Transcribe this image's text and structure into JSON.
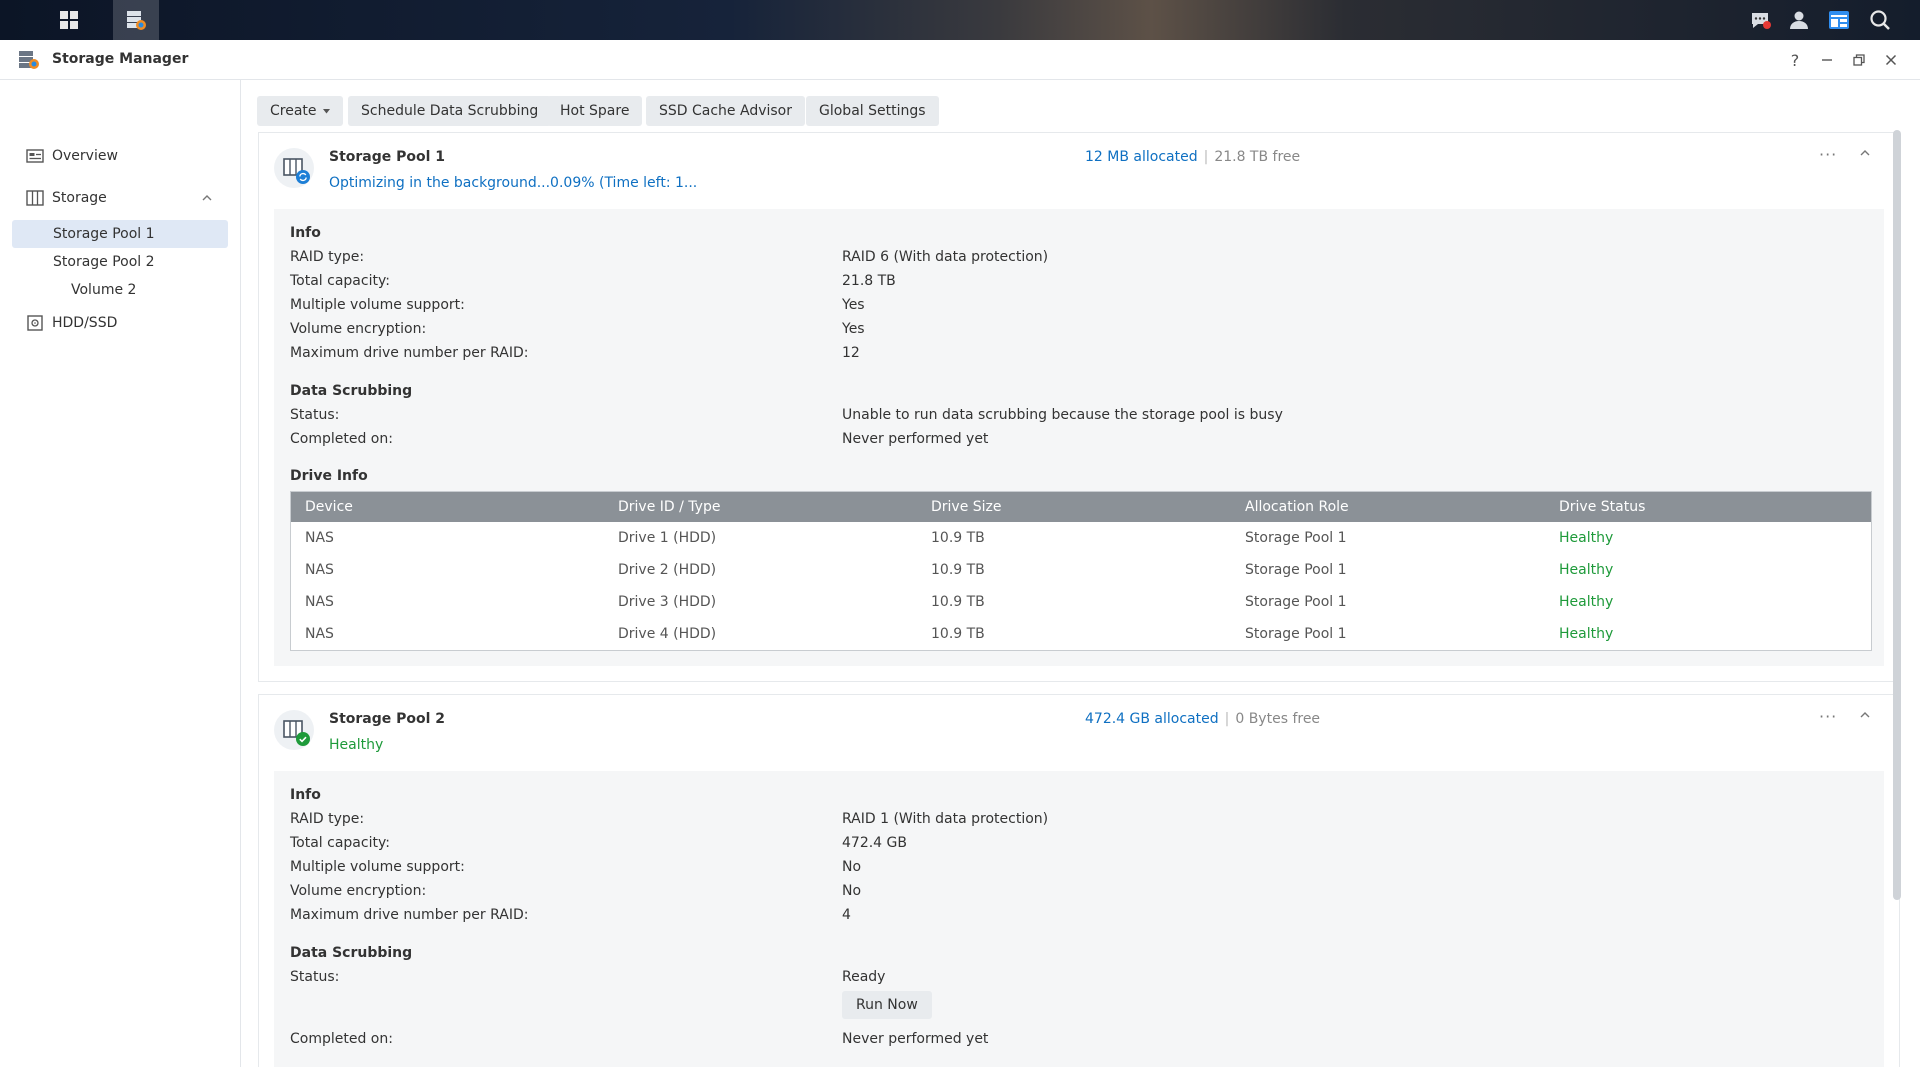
{
  "window": {
    "title": "Storage Manager"
  },
  "controls": {
    "help": "?",
    "minimize": "–",
    "maximize": "□",
    "close": "✕"
  },
  "sidebar": {
    "overview": "Overview",
    "storage": "Storage",
    "storage_pool_1": "Storage Pool 1",
    "storage_pool_2": "Storage Pool 2",
    "volume_2": "Volume 2",
    "hdd_ssd": "HDD/SSD"
  },
  "toolbar": {
    "create": "Create",
    "schedule_scrubbing": "Schedule Data Scrubbing",
    "hot_spare": "Hot Spare",
    "ssd_cache_advisor": "SSD Cache Advisor",
    "global_settings": "Global Settings"
  },
  "pool1": {
    "name": "Storage Pool 1",
    "status": "Optimizing in the background...0.09% (Time left: 1...",
    "allocated": "12 MB allocated",
    "separator": "|",
    "free": "21.8 TB free",
    "info_title": "Info",
    "raid_type_label": "RAID type:",
    "raid_type": "RAID 6 (With data protection)",
    "capacity_label": "Total capacity:",
    "capacity": "21.8 TB",
    "multi_vol_label": "Multiple volume support:",
    "multi_vol": "Yes",
    "encryption_label": "Volume encryption:",
    "encryption": "Yes",
    "max_drive_label": "Maximum drive number per RAID:",
    "max_drive": "12",
    "scrub_title": "Data Scrubbing",
    "scrub_status_label": "Status:",
    "scrub_status": "Unable to run data scrubbing because the storage pool is busy",
    "completed_label": "Completed on:",
    "completed": "Never performed yet",
    "drive_info_title": "Drive Info",
    "table_headers": [
      "Device",
      "Drive ID / Type",
      "Drive Size",
      "Allocation Role",
      "Drive Status"
    ],
    "drives": [
      [
        "NAS",
        "Drive 1 (HDD)",
        "10.9 TB",
        "Storage Pool 1",
        "Healthy"
      ],
      [
        "NAS",
        "Drive 2 (HDD)",
        "10.9 TB",
        "Storage Pool 1",
        "Healthy"
      ],
      [
        "NAS",
        "Drive 3 (HDD)",
        "10.9 TB",
        "Storage Pool 1",
        "Healthy"
      ],
      [
        "NAS",
        "Drive 4 (HDD)",
        "10.9 TB",
        "Storage Pool 1",
        "Healthy"
      ]
    ]
  },
  "pool2": {
    "name": "Storage Pool 2",
    "status": "Healthy",
    "allocated": "472.4 GB allocated",
    "separator": "|",
    "free": "0 Bytes free",
    "info_title": "Info",
    "raid_type_label": "RAID type:",
    "raid_type": "RAID 1 (With data protection)",
    "capacity_label": "Total capacity:",
    "capacity": "472.4 GB",
    "multi_vol_label": "Multiple volume support:",
    "multi_vol": "No",
    "encryption_label": "Volume encryption:",
    "encryption": "No",
    "max_drive_label": "Maximum drive number per RAID:",
    "max_drive": "4",
    "scrub_title": "Data Scrubbing",
    "scrub_status_label": "Status:",
    "scrub_status": "Ready",
    "run_now": "Run Now",
    "completed_label": "Completed on:",
    "completed": "Never performed yet"
  },
  "colors": {
    "accent": "#0f70c2",
    "healthy": "#1e9a3a",
    "selected": "#dfe8f5",
    "table_header": "#8b9197"
  }
}
